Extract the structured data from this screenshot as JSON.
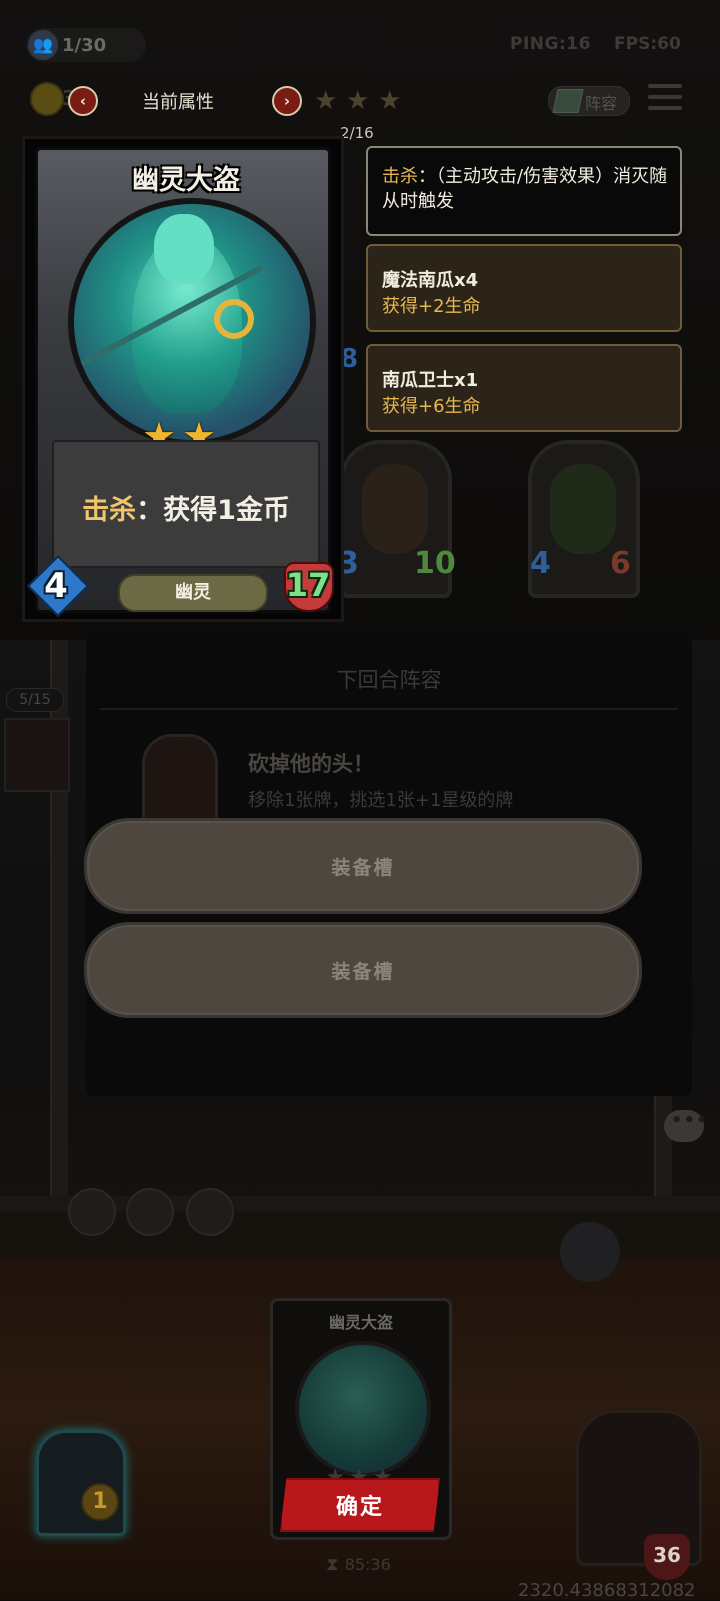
{
  "status_bar": {
    "player_count": "1/30",
    "ping": "PING:16",
    "fps": "FPS:60"
  },
  "header": {
    "gold_partial": "3",
    "attr_title": "当前属性",
    "arrow_left": "‹",
    "arrow_right": "›",
    "stars": [
      "★",
      "★",
      "★"
    ],
    "lineup_button": "阵容",
    "page_indicator": "2/16"
  },
  "card": {
    "name": "幽灵大盗",
    "stars": [
      "★",
      "★"
    ],
    "ability_keyword": "击杀",
    "ability_rest": "：获得1金币",
    "attack": "4",
    "tribe": "幽灵",
    "health": "17"
  },
  "trigger_panel": {
    "keyword": "击杀",
    "text": "：（主动攻击/伤害效果）消灭随从时触发"
  },
  "bonus_panels": [
    {
      "name": "魔法南瓜x4",
      "bonus": "获得+2生命"
    },
    {
      "name": "南瓜卫士x1",
      "bonus": "获得+6生命"
    }
  ],
  "background_minions": [
    {
      "attack": "3",
      "health": "10"
    },
    {
      "attack": "4",
      "health": "6"
    }
  ],
  "partial_stat": "8",
  "lineup": {
    "title": "下回合阵容",
    "event_title": "砍掉他的头！",
    "event_desc": "移除1张牌，挑选1张+1星级的牌",
    "slots": [
      "装备槽",
      "装备槽"
    ]
  },
  "round_badge": "5/15",
  "chat_icon": "•••",
  "bottom": {
    "mini_card_name": "幽灵大盗",
    "mini_stars": "★★★",
    "confirm": "确定",
    "timer_icon": "⧗",
    "timer": "85:36",
    "coords": "2320.43868312082",
    "shop_level": "1",
    "hero_health": "36"
  },
  "colors": {
    "keyword_gold": "#e6b84f",
    "confirm_red": "#b8171c",
    "attack_blue": "#2d78c9",
    "health_green": "#7fe08a"
  }
}
